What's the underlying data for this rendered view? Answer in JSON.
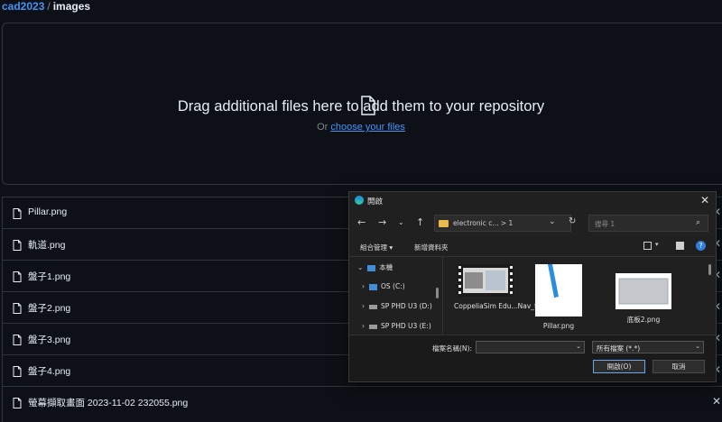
{
  "breadcrumb": {
    "repo": "cad2023",
    "separator": "/",
    "current": "images"
  },
  "dropzone": {
    "title": "Drag additional files here to add them to your repository",
    "prefix": "Or",
    "link": "choose your files"
  },
  "files": [
    "Pillar.png",
    "軌道.png",
    "盤子1.png",
    "盤子2.png",
    "盤子3.png",
    "盤子4.png",
    "螢幕擷取畫面 2023-11-02 232055.png"
  ],
  "dialog": {
    "title": "開啟",
    "address_path": "electronic c... > 1",
    "search_placeholder": "搜尋 1",
    "toolbar": {
      "organize": "組合管理 ▾",
      "new_folder": "新增資料夾"
    },
    "nav": {
      "this_pc": "本機",
      "drives": [
        "OS (C:)",
        "SP PHD U3 (D:)",
        "SP PHD U3 (E:)"
      ]
    },
    "items": [
      {
        "caption": "CoppeliaSim Edu...Nav_file"
      },
      {
        "caption": "Pillar.png"
      },
      {
        "caption": "底板2.png"
      }
    ],
    "file_name_label": "檔案名稱(N):",
    "file_name_value": "",
    "file_type": "所有檔案 (*.*)",
    "open_button": "開啟(O)",
    "cancel_button": "取消"
  }
}
